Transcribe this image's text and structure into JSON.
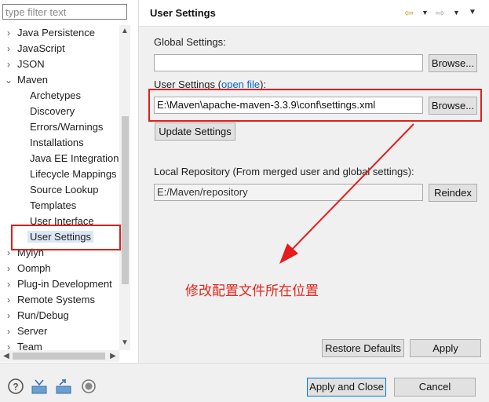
{
  "filter": {
    "placeholder": "type filter text"
  },
  "tree": {
    "items": [
      {
        "label": "Java Persistence",
        "twisty": "›"
      },
      {
        "label": "JavaScript",
        "twisty": "›"
      },
      {
        "label": "JSON",
        "twisty": "›"
      },
      {
        "label": "Maven",
        "twisty": "⌄"
      },
      {
        "label": "Archetypes"
      },
      {
        "label": "Discovery"
      },
      {
        "label": "Errors/Warnings"
      },
      {
        "label": "Installations"
      },
      {
        "label": "Java EE Integration"
      },
      {
        "label": "Lifecycle Mappings"
      },
      {
        "label": "Source Lookup"
      },
      {
        "label": "Templates"
      },
      {
        "label": "User Interface"
      },
      {
        "label": "User Settings",
        "selected": true
      },
      {
        "label": "Mylyn",
        "twisty": "›"
      },
      {
        "label": "Oomph",
        "twisty": "›"
      },
      {
        "label": "Plug-in Development",
        "twisty": "›"
      },
      {
        "label": "Remote Systems",
        "twisty": "›"
      },
      {
        "label": "Run/Debug",
        "twisty": "›"
      },
      {
        "label": "Server",
        "twisty": "›"
      },
      {
        "label": "Team",
        "twisty": "›"
      }
    ]
  },
  "header": {
    "title": "User Settings"
  },
  "global": {
    "label": "Global Settings:",
    "value": "",
    "browse": "Browse..."
  },
  "user": {
    "label_prefix": "User Settings (",
    "link": "open file",
    "label_suffix": "):",
    "value": "E:\\Maven\\apache-maven-3.3.9\\conf\\settings.xml",
    "browse": "Browse...",
    "update": "Update Settings"
  },
  "local": {
    "label": "Local Repository (From merged user and global settings):",
    "value": "E:/Maven/repository",
    "reindex": "Reindex"
  },
  "annotation": "修改配置文件所在位置",
  "buttons": {
    "restore": "Restore Defaults",
    "apply": "Apply",
    "apply_close": "Apply and Close",
    "cancel": "Cancel"
  },
  "colors": {
    "annotation_red": "#e51c1c",
    "link": "#0066cc",
    "panel": "#f0f0f0"
  }
}
